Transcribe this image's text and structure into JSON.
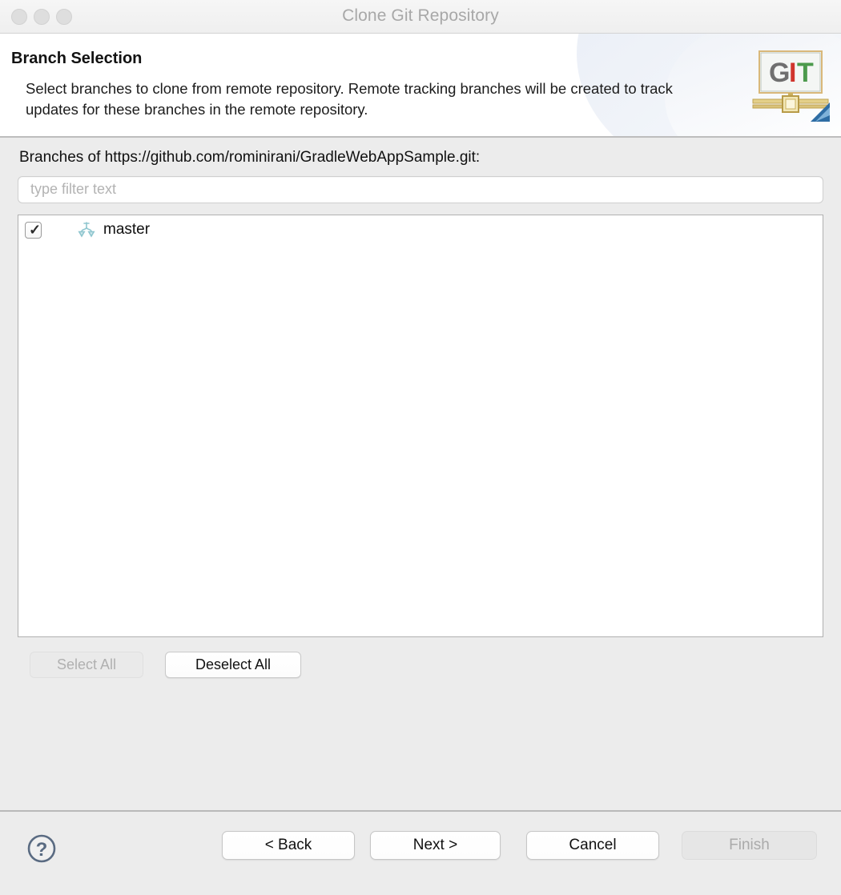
{
  "window": {
    "title": "Clone Git Repository",
    "traffic_lights": [
      "close-button",
      "minimize-button",
      "zoom-button"
    ]
  },
  "banner": {
    "title": "Branch Selection",
    "description": "Select branches to clone from remote repository. Remote tracking branches will be created to track updates for these branches in the remote repository.",
    "logo": {
      "icon": "git-logo-icon",
      "letters": [
        "G",
        "I",
        "T"
      ],
      "letter_colors": [
        "#6f6f6f",
        "#d0342c",
        "#4c9a4c"
      ]
    }
  },
  "main": {
    "branches_label": "Branches of https://github.com/rominirani/GradleWebAppSample.git:",
    "filter": {
      "placeholder": "type filter text",
      "value": ""
    },
    "tree": {
      "columns": [
        "checked",
        "branch"
      ],
      "rows": [
        {
          "checked": true,
          "check_glyph": "✓",
          "icon": "branch-icon",
          "name": "master"
        }
      ]
    },
    "buttons": {
      "select_all": {
        "label": "Select All",
        "enabled": false
      },
      "deselect_all": {
        "label": "Deselect All",
        "enabled": true
      }
    }
  },
  "footer": {
    "help": {
      "icon": "help-question-icon",
      "label": "?"
    },
    "buttons": {
      "back": {
        "label": "< Back",
        "enabled": true
      },
      "next": {
        "label": "Next >",
        "enabled": true
      },
      "cancel": {
        "label": "Cancel",
        "enabled": true
      },
      "finish": {
        "label": "Finish",
        "enabled": false
      }
    }
  },
  "colors": {
    "window_background": "#ececec",
    "banner_background": "#ffffff",
    "title_text": "#a8a8a8",
    "branch_icon": "#8fc6cf",
    "help_icon": "#5a6b82"
  }
}
